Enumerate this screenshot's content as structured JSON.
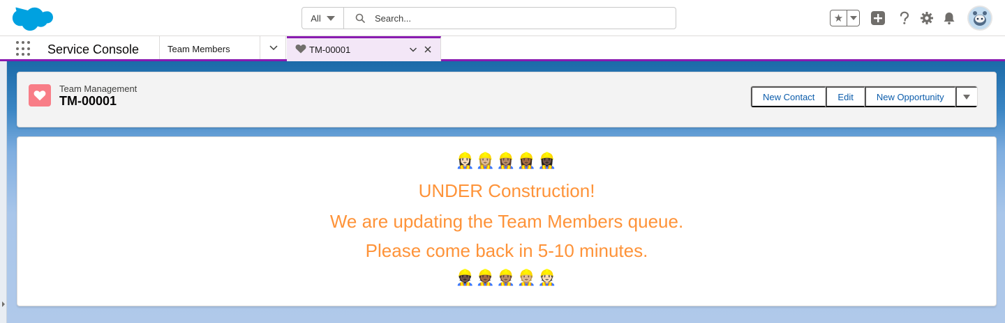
{
  "header": {
    "search": {
      "scope_label": "All",
      "placeholder": "Search..."
    },
    "icons": [
      "salesforce-cloud-logo",
      "favorites-star-icon",
      "add-icon",
      "help-icon",
      "setup-gear-icon",
      "notifications-bell-icon",
      "user-avatar"
    ]
  },
  "nav": {
    "app_name": "Service Console",
    "nav_item_label": "Team Members",
    "active_tab_label": "TM-00001"
  },
  "record": {
    "object_type": "Team Management",
    "name": "TM-00001",
    "actions": [
      "New Contact",
      "Edit",
      "New Opportunity"
    ]
  },
  "content": {
    "emoji_top": "👷🏻‍♀️👷🏼‍♀️👷🏽‍♀️👷🏾‍♀️👷🏿‍♀️",
    "line1": "UNDER Construction!",
    "line2": "We are updating the Team Members queue.",
    "line3": "Please come back in 5-10 minutes.",
    "emoji_bottom": "👷🏿👷🏾👷🏽👷🏼👷🏻"
  },
  "colors": {
    "brand_blue": "#00a1e0",
    "tab_purple": "#8a1bb1",
    "message_orange": "#fe9339",
    "record_icon_pink": "#f87d87",
    "link_blue": "#0b5cab"
  }
}
